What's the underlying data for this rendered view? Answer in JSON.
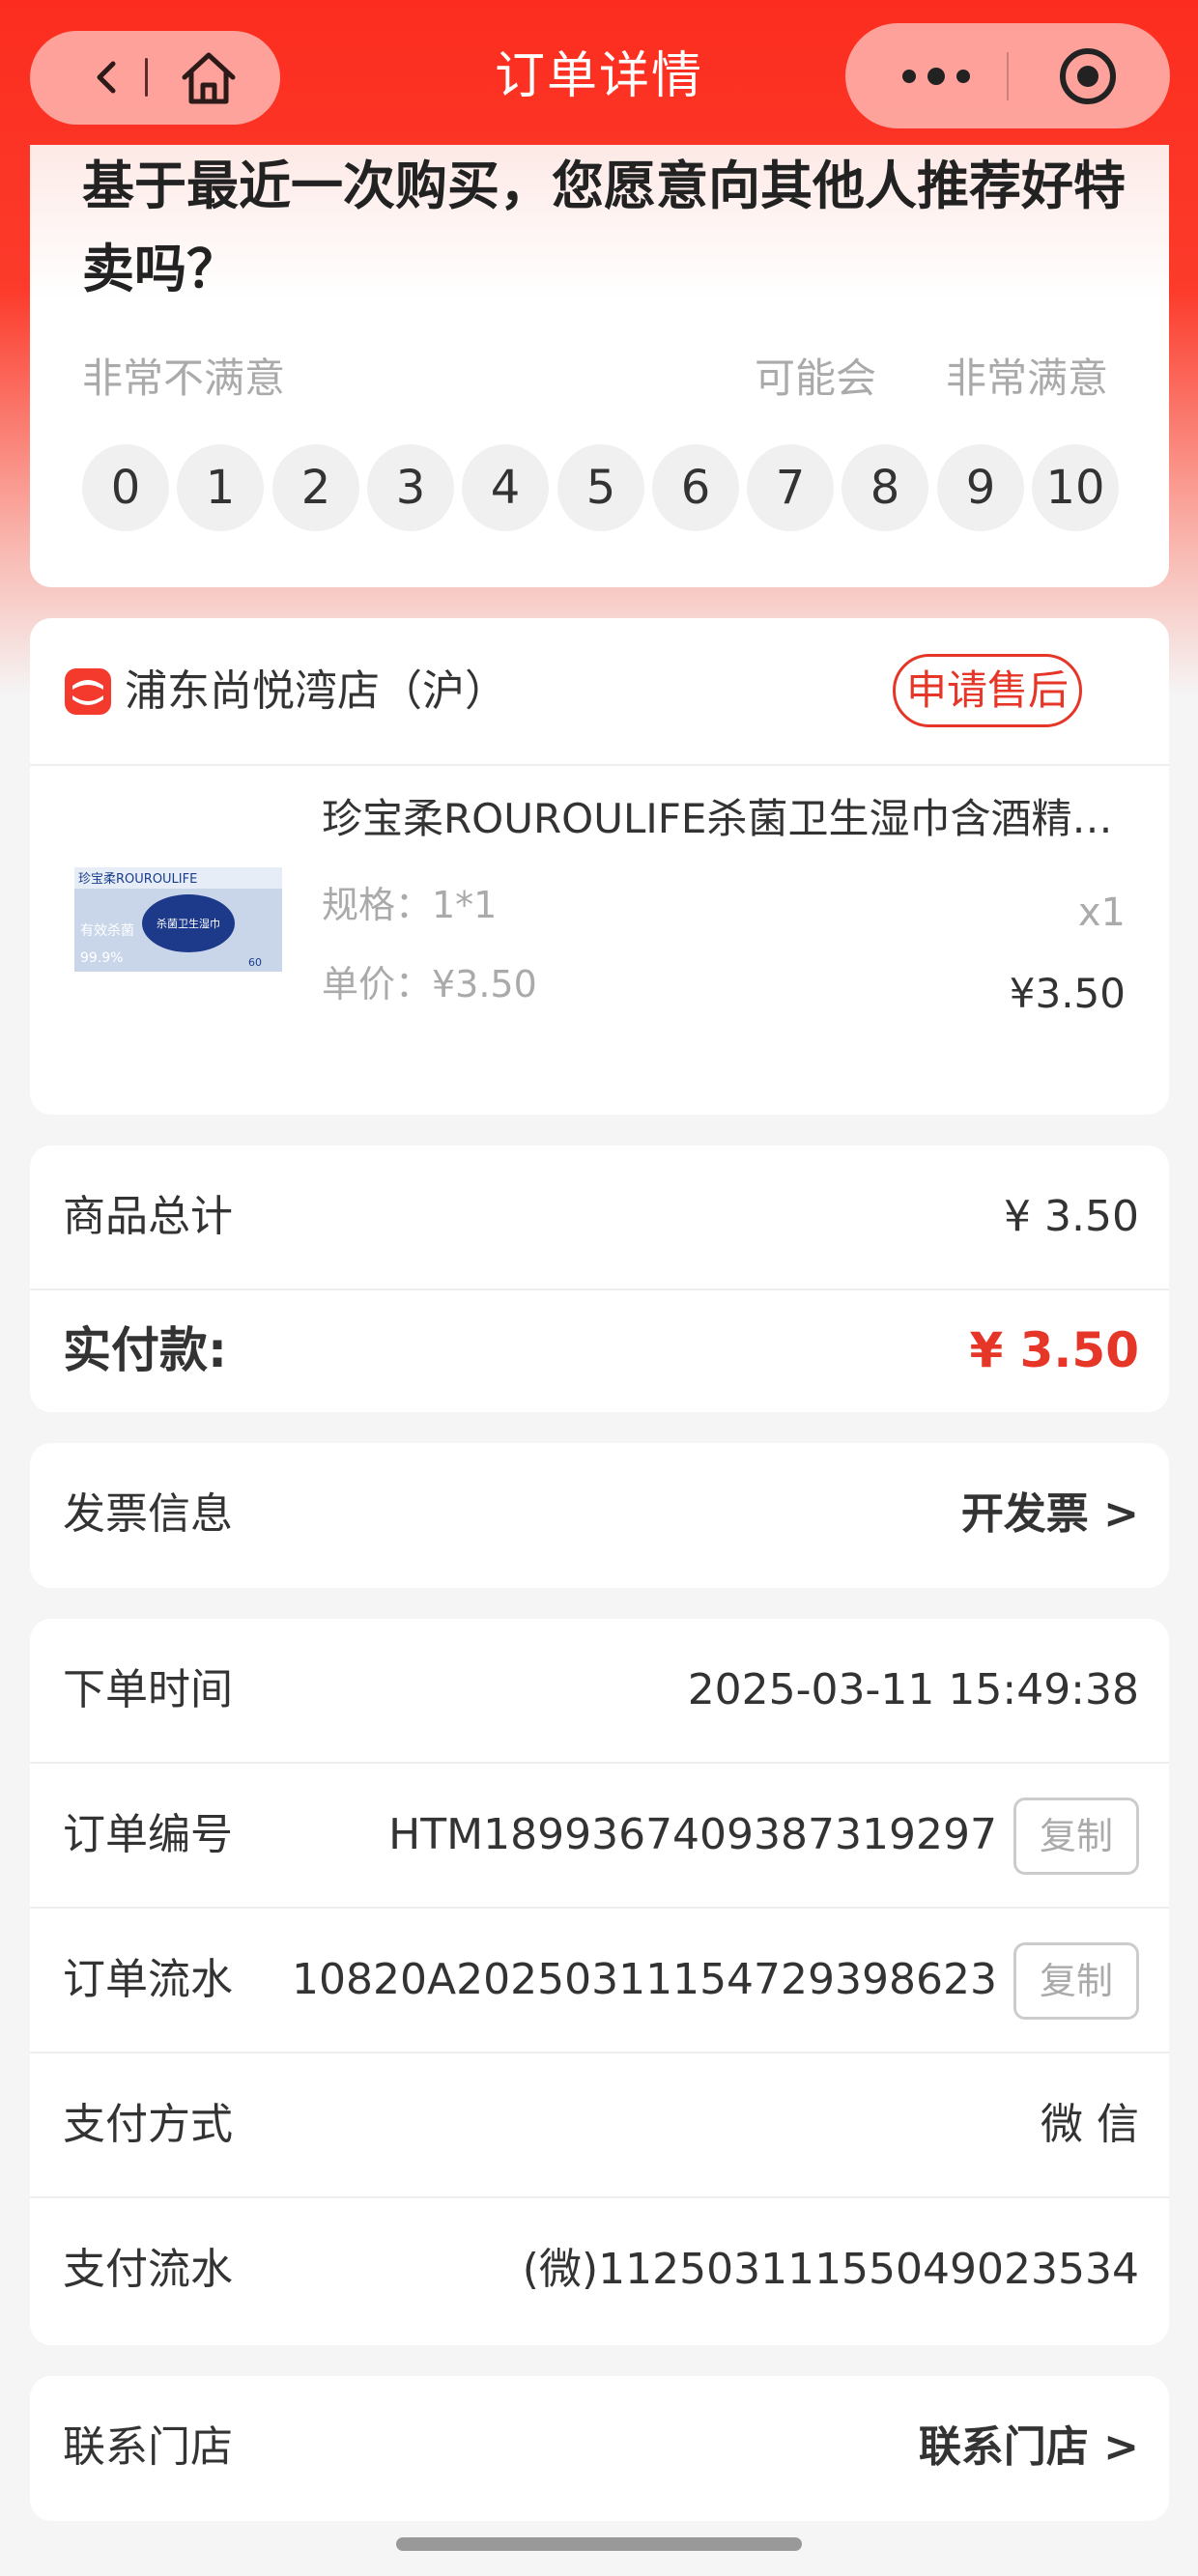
{
  "nav": {
    "title": "订单详情",
    "back_icon": "chevron-left-icon",
    "home_icon": "home-icon",
    "more_icon": "more-dots-icon",
    "close_icon": "target-circle-icon"
  },
  "survey": {
    "question": "基于最近一次购买，您愿意向其他人推荐好特卖吗？",
    "label_left": "非常不满意",
    "label_mid": "可能会",
    "label_right": "非常满意",
    "scores": [
      "0",
      "1",
      "2",
      "3",
      "4",
      "5",
      "6",
      "7",
      "8",
      "9",
      "10"
    ]
  },
  "store": {
    "name": "浦东尚悦湾店（沪）",
    "after_sale": "申请售后",
    "product": {
      "name": "珍宝柔ROUROULIFE杀菌卫生湿巾含酒精抑菌擦手湿纸巾",
      "spec": "规格：1*1",
      "quantity": "x1",
      "unit_price": "单价：¥3.50",
      "price": "¥3.50",
      "thumb_brand": "珍宝柔ROUROULIFE",
      "thumb_center": "杀菌卫生湿巾",
      "thumb_left": "有效杀菌",
      "thumb_percent": "99.9%",
      "thumb_count": "60"
    }
  },
  "totals": {
    "goods_label": "商品总计",
    "goods_value": "¥ 3.50",
    "paid_label": "实付款:",
    "paid_value": "¥ 3.50"
  },
  "invoice": {
    "label": "发票信息",
    "action": "开发票 >"
  },
  "info": {
    "order_time_label": "下单时间",
    "order_time": "2025-03-11 15:49:38",
    "order_no_label": "订单编号",
    "order_no": "HTM1899367409387319297",
    "serial_label": "订单流水",
    "serial": "10820A20250311154729398623",
    "copy_label": "复制",
    "pay_method_label": "支付方式",
    "pay_method": "微 信",
    "pay_serial_label": "支付流水",
    "pay_serial": "(微)112503111550490235​34"
  },
  "contact": {
    "label": "联系门店",
    "action": "联系门店 >"
  },
  "colors": {
    "brand_red": "#fc2d1f",
    "accent_red": "#e53628"
  }
}
